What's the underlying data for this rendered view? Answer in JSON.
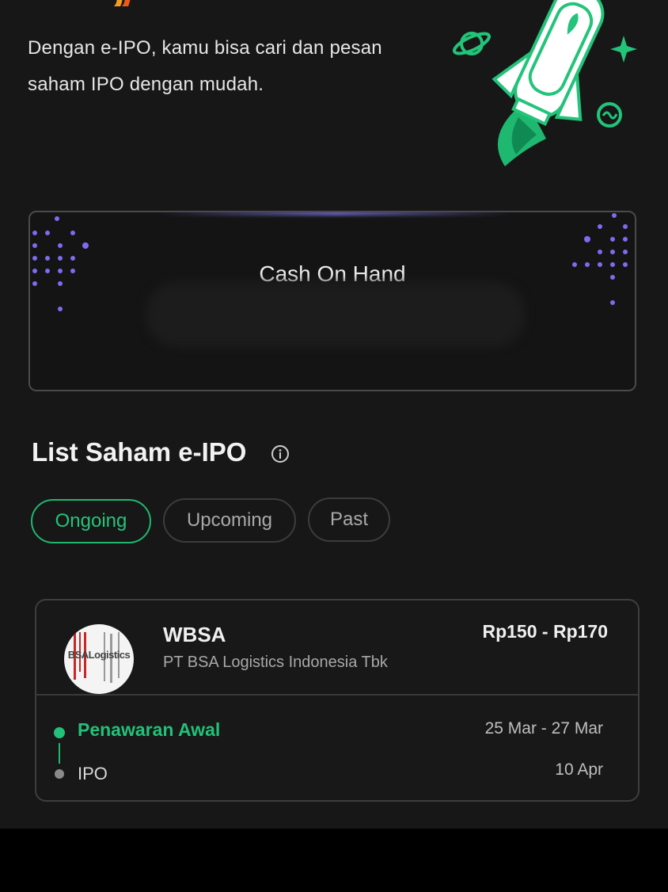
{
  "hero": {
    "description": "Dengan e-IPO, kamu bisa cari dan pesan saham IPO dengan mudah."
  },
  "cash": {
    "label": "Cash On Hand"
  },
  "section": {
    "title": "List Saham e-IPO"
  },
  "tabs": [
    {
      "label": "Ongoing",
      "active": true
    },
    {
      "label": "Upcoming",
      "active": false
    },
    {
      "label": "Past",
      "active": false
    }
  ],
  "ipo_list": [
    {
      "logo_text": "BSALogistics",
      "ticker": "WBSA",
      "company": "PT BSA Logistics Indonesia Tbk",
      "price_range": "Rp150 - Rp170",
      "stages": [
        {
          "name": "Penawaran Awal",
          "date": "25 Mar - 27 Mar",
          "status": "active"
        },
        {
          "name": "IPO",
          "date": "10 Apr",
          "status": "pending"
        }
      ]
    }
  ],
  "colors": {
    "accent": "#22c179",
    "background": "#171717",
    "card_border": "#3e3e3e",
    "dots": "#7b6cf0"
  }
}
